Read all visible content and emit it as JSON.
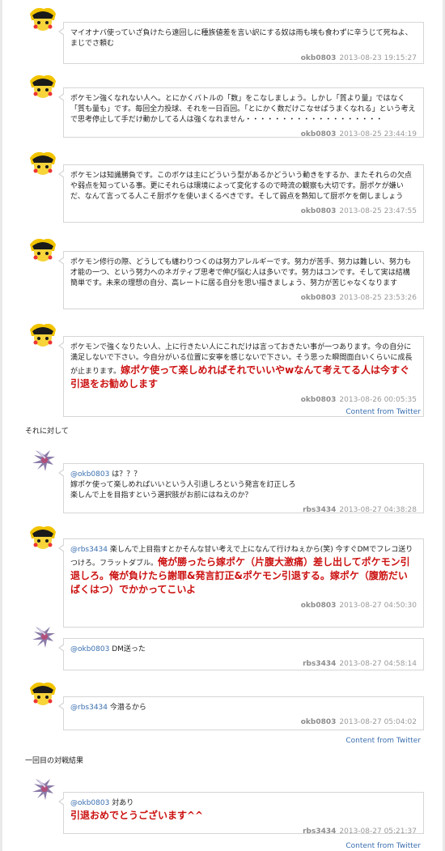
{
  "tweets": [
    {
      "user": "okb0803",
      "time": "2013-08-23 19:15:27",
      "text": "マイオナバ使っていざ負けたら遠回しに種族値差を言い訳にする奴は雨も埃も食わずに辛うじて死ねよ、まじでさ頼む"
    },
    {
      "user": "okb0803",
      "time": "2013-08-25 23:44:19",
      "text": "ポケモン強くなれない人へ。とにかくバトルの「数」をこなしましょう。しかし「質より量」ではなく「質も量も」です。毎回全力投球、それを一日百回。「とにかく数だけこなせばうまくなれる」という考えで思考停止して手だけ動かしてる人は強くなれません・・・・・・・・・・・・・・・・・・・"
    },
    {
      "user": "okb0803",
      "time": "2013-08-25 23:47:55",
      "text": "ポケモンは知識勝負です。このポケは主にどういう型があるかどういう動きをするか、またそれらの欠点や弱点を知っている事。更にそれらは環境によって変化するので時流の観察も大切です。厨ポケが嫌いだ、なんて言ってる人こそ厨ポケを使いまくるべきです。そして弱点を熟知して厨ポケを倒しましょう"
    },
    {
      "user": "okb0803",
      "time": "2013-08-25 23:53:26",
      "text": "ポケモン修行の際、どうしても纏わりつくのは努力アレルギーです。努力が苦手、努力は難しい、努力も才能の一つ、という努力へのネガティブ思考で伸び悩む人は多いです。努力はコンです。そして実は結構簡単です。未来の理想の自分、高レートに居る自分を思い描きましょう、努力が苦じゃなくなります"
    },
    {
      "user": "okb0803",
      "time": "2013-08-26 00:05:35",
      "text": "ポケモンで強くなりたい人、上に行きたい人にこれだけは言っておきたい事が一つあります。今の自分に満足しないで下さい。今自分がいる位置に安寧を感じないで下さい。そう思った瞬間面白いくらいに成長が止まります。",
      "red": "嫁ポケ使って楽しめればそれでいいやwなんて考えてる人は今すぐ引退をお勧めします"
    },
    {
      "user": "rbs3434",
      "time": "2013-08-27 04:38:28",
      "mention": "@okb0803",
      "text": " は？？？\n嫁ポケ使って楽しめればいいという人引退しろという発言を訂正しろ\n楽しんで上を目指すという選択肢がお前にはねえのか？"
    },
    {
      "user": "okb0803",
      "time": "2013-08-27 04:50:30",
      "mention": "@rbs3434",
      "text": " 楽しんで上目指すとかそんな甘い考えで上になんて行けねぇから(笑) 今すぐDMでフレコ送りつけろ。フラットダブル。",
      "red": "俺が勝ったら嫁ポケ（片腹大激痛）差し出してポケモン引退しろ。俺が負けたら謝罪&発言訂正&ポケモン引退する。嫁ポケ（腹筋だいばくはつ）でかかってこいよ"
    },
    {
      "user": "rbs3434",
      "time": "2013-08-27 04:58:14",
      "mention": "@okb0803",
      "text": " DM送った"
    },
    {
      "user": "okb0803",
      "time": "2013-08-27 05:04:02",
      "mention": "@rbs3434",
      "text": " 今潜るから"
    },
    {
      "user": "rbs3434",
      "time": "2013-08-27 05:21:37",
      "mention": "@okb0803",
      "text": " 対あり",
      "red": "引退おめでとうございます^^"
    }
  ],
  "content_from": "Content from Twitter",
  "labels": {
    "response": "それに対して",
    "first_result": "一回目の対戦結果"
  }
}
